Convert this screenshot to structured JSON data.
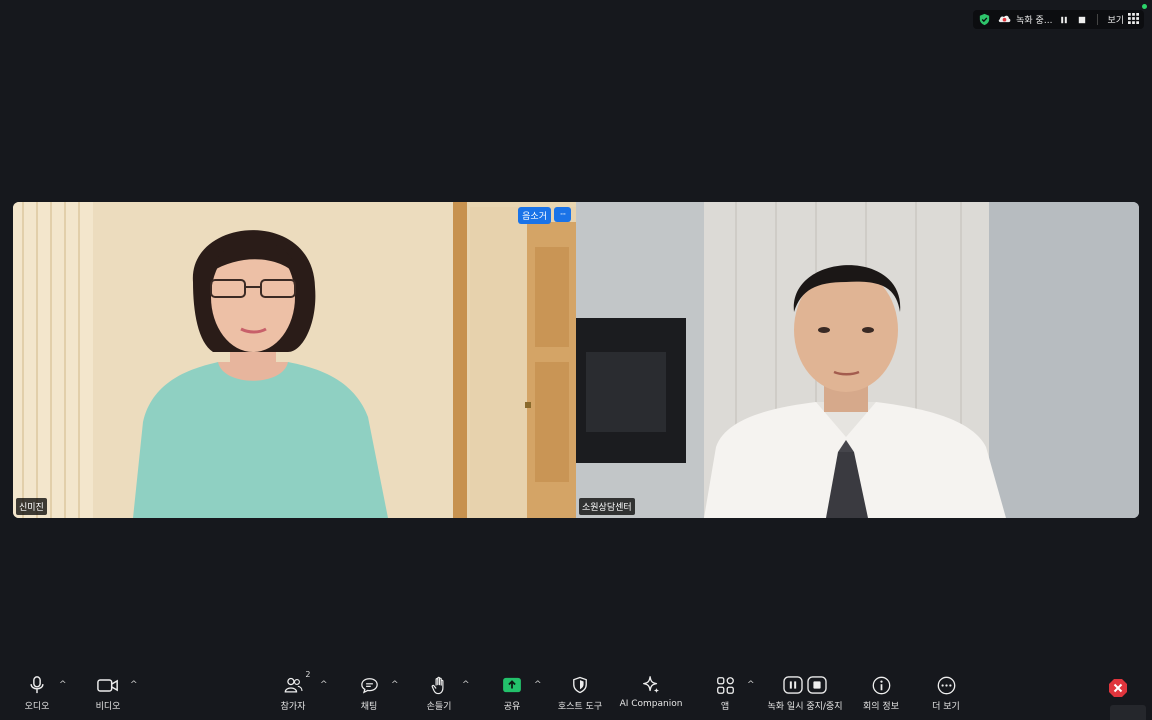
{
  "status": {
    "recording_label": "녹화 중...",
    "view_label": "보기"
  },
  "tiles": [
    {
      "name": "신미진",
      "mute_label": "음소거",
      "more_label": "···"
    },
    {
      "name": "소원상담센터"
    }
  ],
  "toolbar": {
    "audio": "오디오",
    "video": "비디오",
    "participants": "참가자",
    "participants_count": "2",
    "chat": "채팅",
    "raise_hand": "손들기",
    "share": "공유",
    "host_tools": "호스트 도구",
    "ai_companion": "AI Companion",
    "apps": "앱",
    "recording_control": "녹화 일시 중지/중지",
    "meeting_info": "회의 정보",
    "more": "더 보기"
  },
  "colors": {
    "accent": "#1a73e8",
    "share_green": "#23c16b",
    "end_red": "#e0353d"
  },
  "icons": [
    "shield-icon",
    "cloud-record-icon",
    "pause-icon",
    "stop-icon",
    "grid-icon",
    "mic-icon",
    "camera-icon",
    "people-icon",
    "chat-icon",
    "hand-icon",
    "share-icon",
    "host-shield-icon",
    "sparkle-icon",
    "apps-icon",
    "record-pause-icon",
    "record-stop-icon",
    "info-icon",
    "more-icon",
    "end-icon"
  ]
}
